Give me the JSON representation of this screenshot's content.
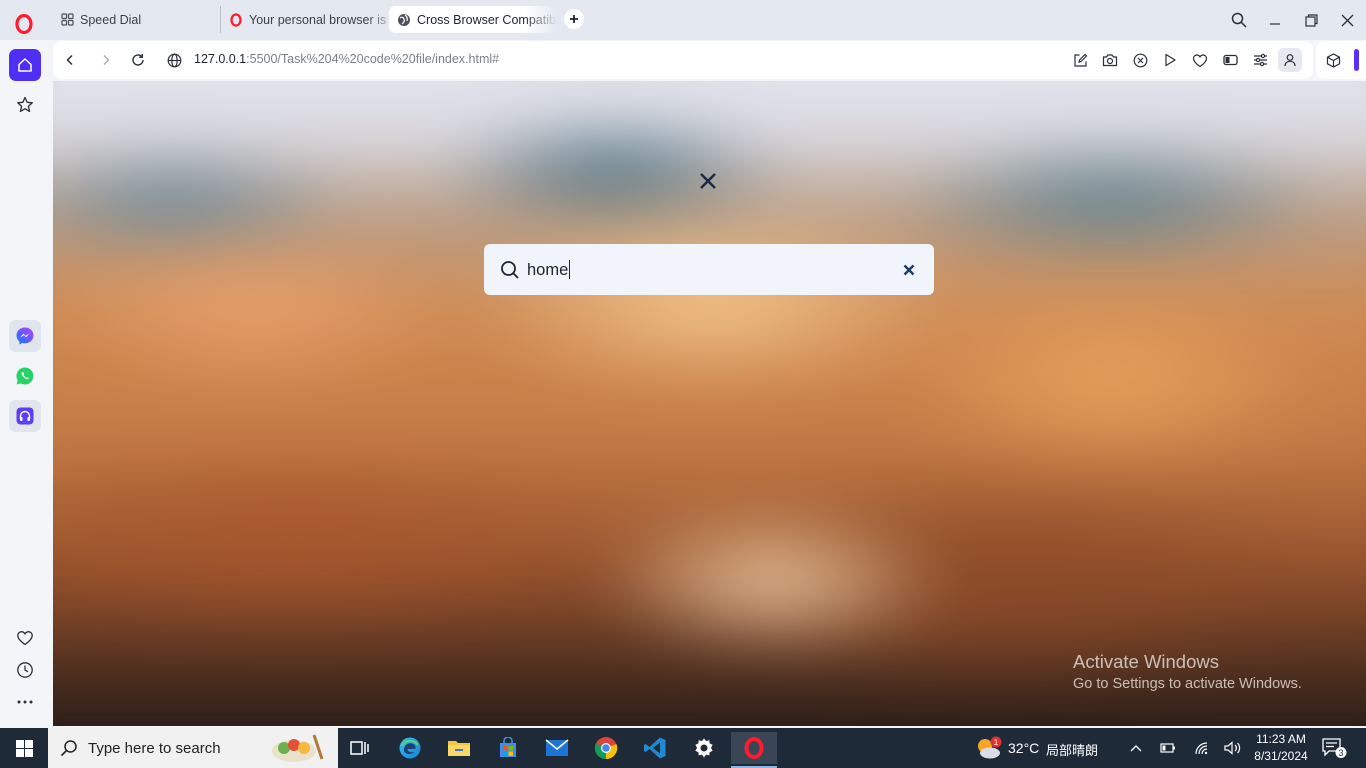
{
  "tabs": [
    {
      "label": "Speed Dial",
      "icon": "speed-dial-icon"
    },
    {
      "label": "Your personal browser is a",
      "icon": "opera-icon"
    },
    {
      "label": "Cross Browser Compatibil",
      "icon": "globe-icon"
    }
  ],
  "address": {
    "host": "127.0.0.1",
    "rest": ":5500/Task%204%20code%20file/index.html#"
  },
  "search": {
    "value": "home",
    "placeholder": ""
  },
  "watermark": {
    "title": "Activate Windows",
    "subtitle": "Go to Settings to activate Windows."
  },
  "taskbar": {
    "search_label": "Type here to search",
    "weather_temp": "32°C",
    "weather_desc": "局部晴朗",
    "weather_alert": "1",
    "time": "11:23 AM",
    "date": "8/31/2024",
    "notification_count": "3"
  },
  "colors": {
    "accent": "#4f2ff5",
    "taskbar": "#1f2a38"
  }
}
